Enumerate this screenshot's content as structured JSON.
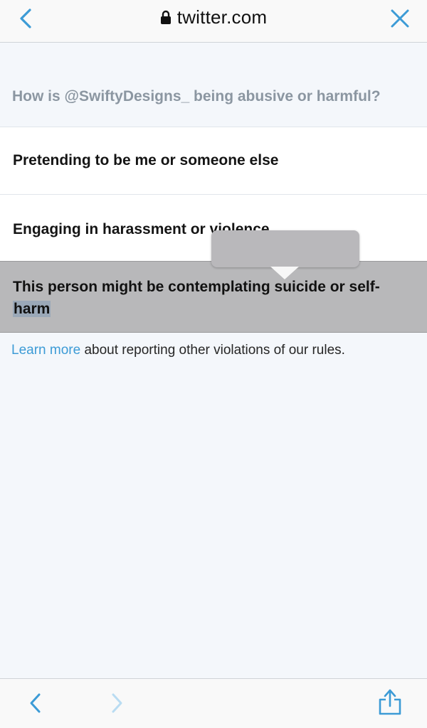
{
  "browser": {
    "url": "twitter.com"
  },
  "report": {
    "question": "How is @SwiftyDesigns_ being abusive or harmful?",
    "options": [
      {
        "label": "Pretending to be me or someone else"
      },
      {
        "label": "Engaging in harassment or violence"
      },
      {
        "label_start": "This person might be contemplating suicide or self-",
        "label_selected": "harm"
      }
    ],
    "footnote": {
      "link_text": "Learn more",
      "text": " about reporting other violations of our rules."
    }
  },
  "colors": {
    "accent": "#3c9bd6",
    "question_gray": "#8b96a1",
    "selected_row_bg": "#b8b8ba"
  },
  "icons": {
    "back": "chevron-left-icon",
    "close": "close-icon",
    "lock": "lock-icon",
    "forward": "chevron-right-icon",
    "share": "share-icon"
  }
}
